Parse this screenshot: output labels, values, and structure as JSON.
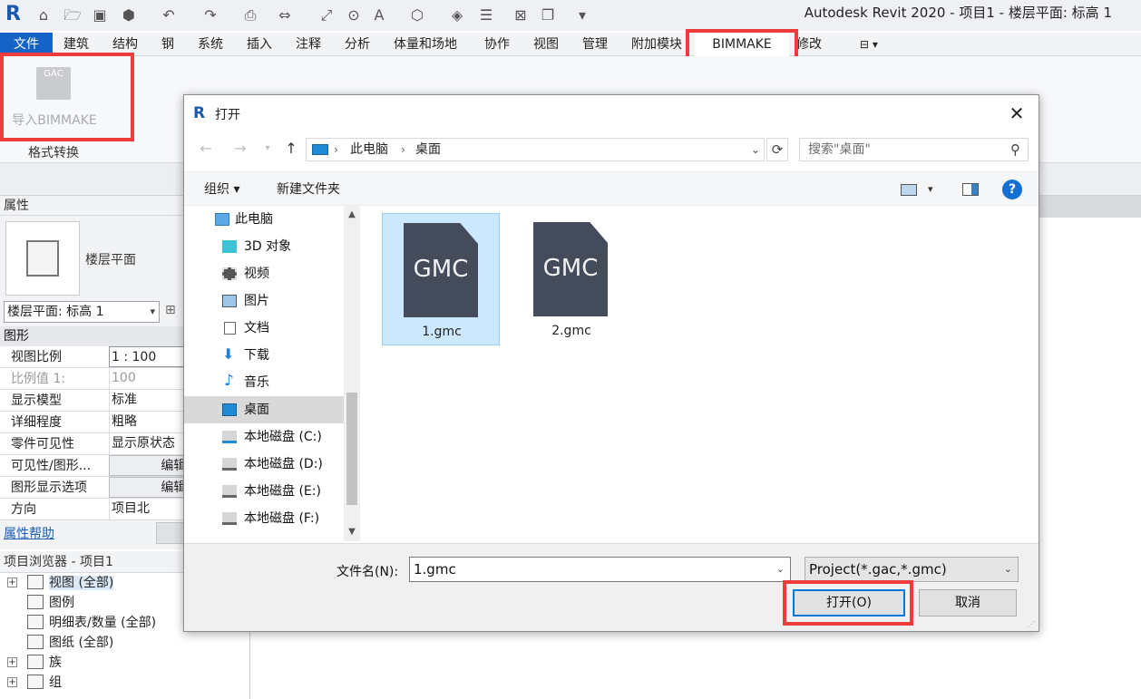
{
  "app": {
    "logo": "R",
    "title": "Autodesk Revit 2020 - 项目1 - 楼层平面: 标高 1"
  },
  "ribbon": {
    "tabs": [
      "文件",
      "建筑",
      "结构",
      "钢",
      "系统",
      "插入",
      "注释",
      "分析",
      "体量和场地",
      "协作",
      "视图",
      "管理",
      "附加模块",
      "BIMMAKE",
      "修改"
    ],
    "import_button": "导入BIMMAKE",
    "import_icon_text": "GAC",
    "panel_caption": "格式转换"
  },
  "properties": {
    "header": "属性",
    "type_name": "楼层平面",
    "type_selector": "楼层平面: 标高 1",
    "group": "图形",
    "rows": [
      {
        "k": "视图比例",
        "v": "1 : 100"
      },
      {
        "k": "比例值 1:",
        "v": "100"
      },
      {
        "k": "显示模型",
        "v": "标准"
      },
      {
        "k": "详细程度",
        "v": "粗略"
      },
      {
        "k": "零件可见性",
        "v": "显示原状态"
      },
      {
        "k": "可见性/图形...",
        "v": "编辑..."
      },
      {
        "k": "图形显示选项",
        "v": "编辑..."
      },
      {
        "k": "方向",
        "v": "项目北"
      }
    ],
    "help_link": "属性帮助"
  },
  "browser": {
    "header": "项目浏览器 - 项目1",
    "items": [
      "视图 (全部)",
      "图例",
      "明细表/数量 (全部)",
      "图纸 (全部)",
      "族",
      "组"
    ]
  },
  "dialog": {
    "icon": "R",
    "title": "打开",
    "close": "✕",
    "breadcrumb": [
      "此电脑",
      "桌面"
    ],
    "search_placeholder": "搜索\"桌面\"",
    "organize": "组织 ▾",
    "new_folder": "新建文件夹",
    "help": "?",
    "nav_items": [
      "此电脑",
      "3D 对象",
      "视频",
      "图片",
      "文档",
      "下载",
      "音乐",
      "桌面",
      "本地磁盘 (C:)",
      "本地磁盘 (D:)",
      "本地磁盘 (E:)",
      "本地磁盘 (F:)"
    ],
    "files": [
      {
        "name": "1.gmc",
        "icon_text": "GMC"
      },
      {
        "name": "2.gmc",
        "icon_text": "GMC"
      }
    ],
    "filename_label": "文件名(N):",
    "filename_value": "1.gmc",
    "filetype_value": "Project(*.gac,*.gmc)",
    "open_button": "打开(O)",
    "cancel_button": "取消"
  },
  "colors": {
    "file_tab": "#1663c7",
    "highlight": "#ee3b3b",
    "selection": "#cce8ff",
    "doc_icon": "#444c5c"
  }
}
